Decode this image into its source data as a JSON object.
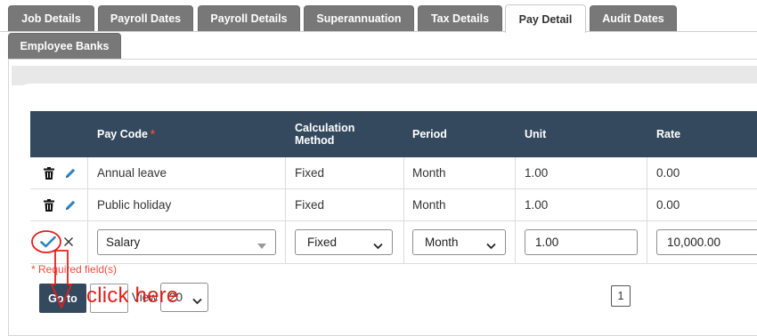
{
  "tabs": [
    {
      "label": "Job Details",
      "active": false
    },
    {
      "label": "Payroll Dates",
      "active": false
    },
    {
      "label": "Payroll Details",
      "active": false
    },
    {
      "label": "Superannuation",
      "active": false
    },
    {
      "label": "Tax Details",
      "active": false
    },
    {
      "label": "Pay Detail",
      "active": true
    },
    {
      "label": "Audit Dates",
      "active": false
    },
    {
      "label": "Employee Banks",
      "active": false
    }
  ],
  "table": {
    "headers": {
      "pay_code": "Pay Code",
      "pay_code_required": "*",
      "calc_method_line1": "Calculation",
      "calc_method_line2": "Method",
      "period": "Period",
      "unit": "Unit",
      "rate": "Rate"
    },
    "rows": [
      {
        "pay_code": "Annual leave",
        "calc_method": "Fixed",
        "period": "Month",
        "unit": "1.00",
        "rate": "0.00"
      },
      {
        "pay_code": "Public holiday",
        "calc_method": "Fixed",
        "period": "Month",
        "unit": "1.00",
        "rate": "0.00"
      }
    ],
    "edit_row": {
      "pay_code": "Salary",
      "calc_method": "Fixed",
      "period": "Month",
      "unit": "1.00",
      "rate": "10,000.00"
    }
  },
  "footer": {
    "required_note": "* Required field(s)",
    "goto_label": "Go to",
    "goto_value": "",
    "view_label": "View",
    "view_value": "20",
    "page_number": "1"
  },
  "annotation": {
    "text": "click here",
    "color": "#e0201d"
  },
  "colors": {
    "tab_bg": "#787878",
    "header_bg": "#34495e",
    "required": "#e74c3c",
    "check": "#2e86c1"
  },
  "icons": [
    "trash-icon",
    "edit-pencil-icon",
    "check-icon",
    "close-icon",
    "chevron-down-icon"
  ]
}
